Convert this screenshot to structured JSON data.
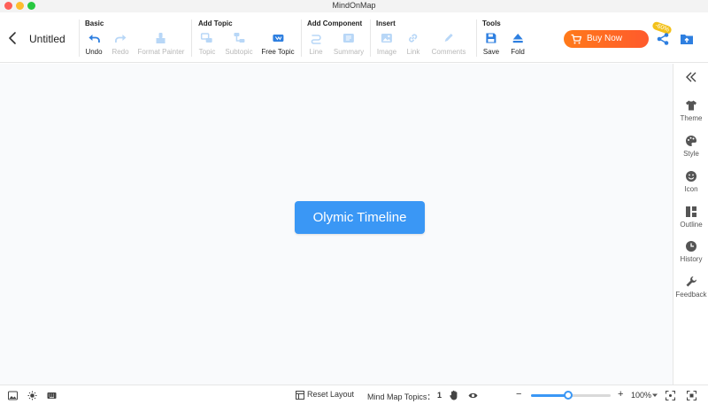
{
  "window": {
    "title": "MindOnMap"
  },
  "document": {
    "title": "Untitled"
  },
  "groups": {
    "basic": "Basic",
    "add_topic": "Add Topic",
    "add_component": "Add Component",
    "insert": "Insert",
    "tools": "Tools"
  },
  "tools": {
    "undo": "Undo",
    "redo": "Redo",
    "format_painter": "Format Painter",
    "topic": "Topic",
    "subtopic": "Subtopic",
    "free_topic": "Free Topic",
    "line": "Line",
    "summary": "Summary",
    "image": "Image",
    "link": "Link",
    "comments": "Comments",
    "save": "Save",
    "fold": "Fold"
  },
  "promo": {
    "label": "Buy Now",
    "badge": "-60%"
  },
  "canvas": {
    "central_topic": "Olymic Timeline"
  },
  "right_panel": {
    "theme": "Theme",
    "style": "Style",
    "icon": "Icon",
    "outline": "Outline",
    "history": "History",
    "feedback": "Feedback"
  },
  "status": {
    "reset_layout": "Reset Layout",
    "topics_label": "Mind Map Topics：",
    "topics_count": "1",
    "zoom_minus": "−",
    "zoom_plus": "+",
    "zoom_value": "100%",
    "zoom_level": 0.47
  },
  "colors": {
    "accent": "#3a97f5",
    "promo": "#ff6a22",
    "disabled": "#b8b8b8"
  }
}
